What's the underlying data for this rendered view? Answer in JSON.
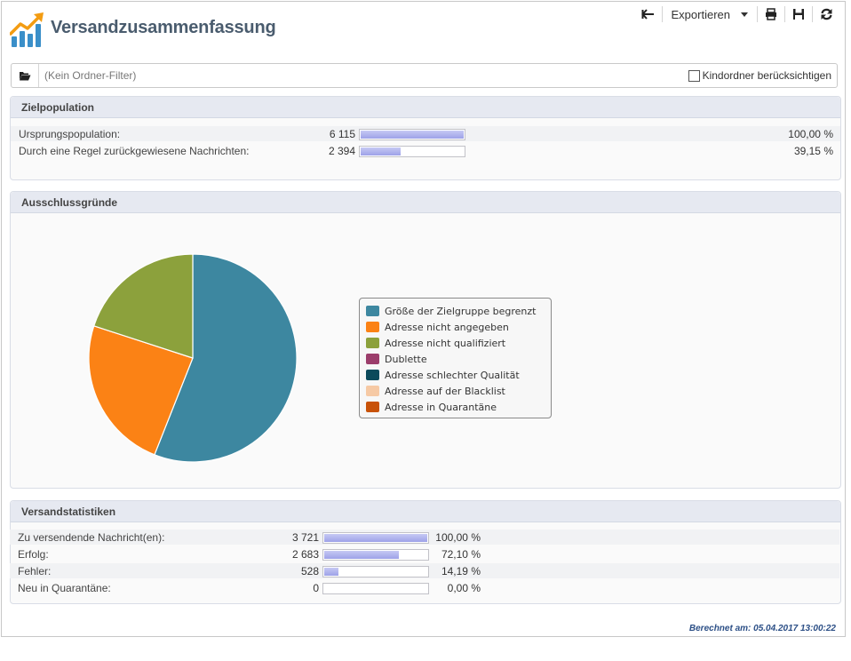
{
  "header": {
    "title": "Versandzusammenfassung",
    "toolbar": {
      "back_icon": "back-arrow-icon",
      "export_label": "Exportieren",
      "print_icon": "printer-icon",
      "save_icon": "floppy-disk-icon",
      "refresh_icon": "refresh-icon"
    }
  },
  "filter": {
    "folder_icon": "folder-open-icon",
    "placeholder": "(Kein Ordner-Filter)",
    "include_subfolders_label": "Kindordner berücksichtigen",
    "include_subfolders_checked": false
  },
  "target_population": {
    "title": "Zielpopulation",
    "rows": [
      {
        "label": "Ursprungspopulation:",
        "value": "6 115",
        "percent_text": "100,00 %",
        "fraction": 1.0
      },
      {
        "label": "Durch eine Regel zurückgewiesene Nachrichten:",
        "value": "2 394",
        "percent_text": "39,15 %",
        "fraction": 0.3915
      }
    ]
  },
  "exclusion": {
    "title": "Ausschlussgründe",
    "chart_data": {
      "type": "pie",
      "slices": [
        {
          "label": "Größe der Zielgruppe begrenzt",
          "value": 56,
          "color": "#3d87a0"
        },
        {
          "label": "Adresse nicht angegeben",
          "value": 24,
          "color": "#fb8215"
        },
        {
          "label": "Adresse nicht qualifiziert",
          "value": 20,
          "color": "#8ca13c"
        },
        {
          "label": "Dublette",
          "value": 0,
          "color": "#9b3d6b"
        },
        {
          "label": "Adresse schlechter Qualität",
          "value": 0,
          "color": "#0b4a5b"
        },
        {
          "label": "Adresse auf der Blacklist",
          "value": 0,
          "color": "#f6c9a4"
        },
        {
          "label": "Adresse in Quarantäne",
          "value": 0,
          "color": "#c85208"
        }
      ]
    }
  },
  "delivery_stats": {
    "title": "Versandstatistiken",
    "rows": [
      {
        "label": "Zu versendende Nachricht(en):",
        "value": "3 721",
        "percent_text": "100,00 %",
        "fraction": 1.0
      },
      {
        "label": "Erfolg:",
        "value": "2 683",
        "percent_text": "72,10 %",
        "fraction": 0.721
      },
      {
        "label": "Fehler:",
        "value": "528",
        "percent_text": "14,19 %",
        "fraction": 0.1419
      },
      {
        "label": "Neu in Quarantäne:",
        "value": "0",
        "percent_text": "0,00 %",
        "fraction": 0.0
      }
    ]
  },
  "footer": {
    "computed_at": "Berechnet am: 05.04.2017 13:00:22"
  }
}
